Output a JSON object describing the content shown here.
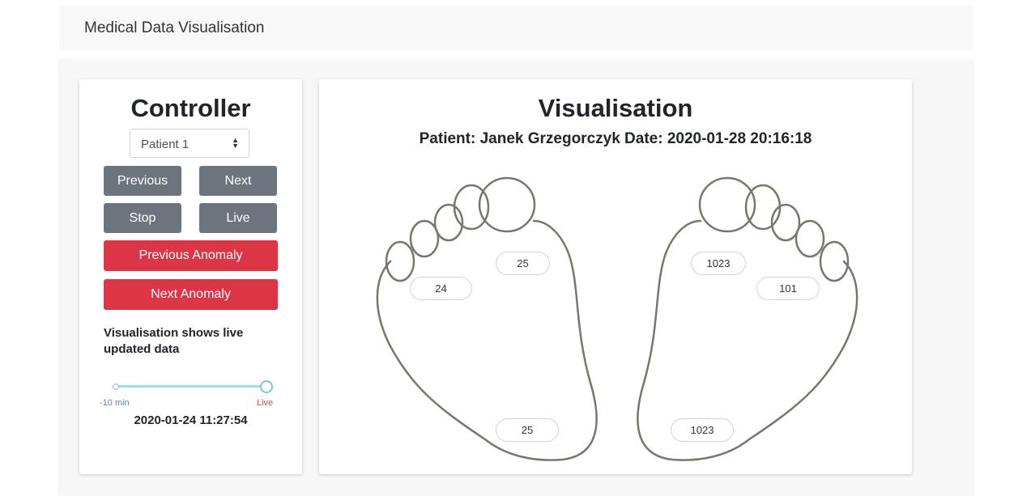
{
  "navbar": {
    "brand": "Medical Data Visualisation"
  },
  "controller": {
    "title": "Controller",
    "patient_select": {
      "selected": "Patient 1"
    },
    "buttons": {
      "previous": "Previous",
      "next": "Next",
      "stop": "Stop",
      "live": "Live",
      "previous_anomaly": "Previous Anomaly",
      "next_anomaly": "Next Anomaly"
    },
    "status_text": "Visualisation shows live updated data",
    "slider": {
      "min_label": "-10 min",
      "max_label": "Live",
      "value_fraction": 1.0,
      "date": "2020-01-24 11:27:54"
    }
  },
  "visualisation": {
    "title": "Visualisation",
    "patient_line": "Patient: Janek Grzegorczyk Date: 2020-01-28 20:16:18",
    "left_foot": {
      "sensor_top": "25",
      "sensor_mid": "24",
      "sensor_heel": "25"
    },
    "right_foot": {
      "sensor_top": "1023",
      "sensor_mid": "101",
      "sensor_heel": "1023"
    }
  },
  "colors": {
    "secondary_button": "#6c757d",
    "danger_button": "#dc3545",
    "slider_accent": "#7fc3e8"
  }
}
